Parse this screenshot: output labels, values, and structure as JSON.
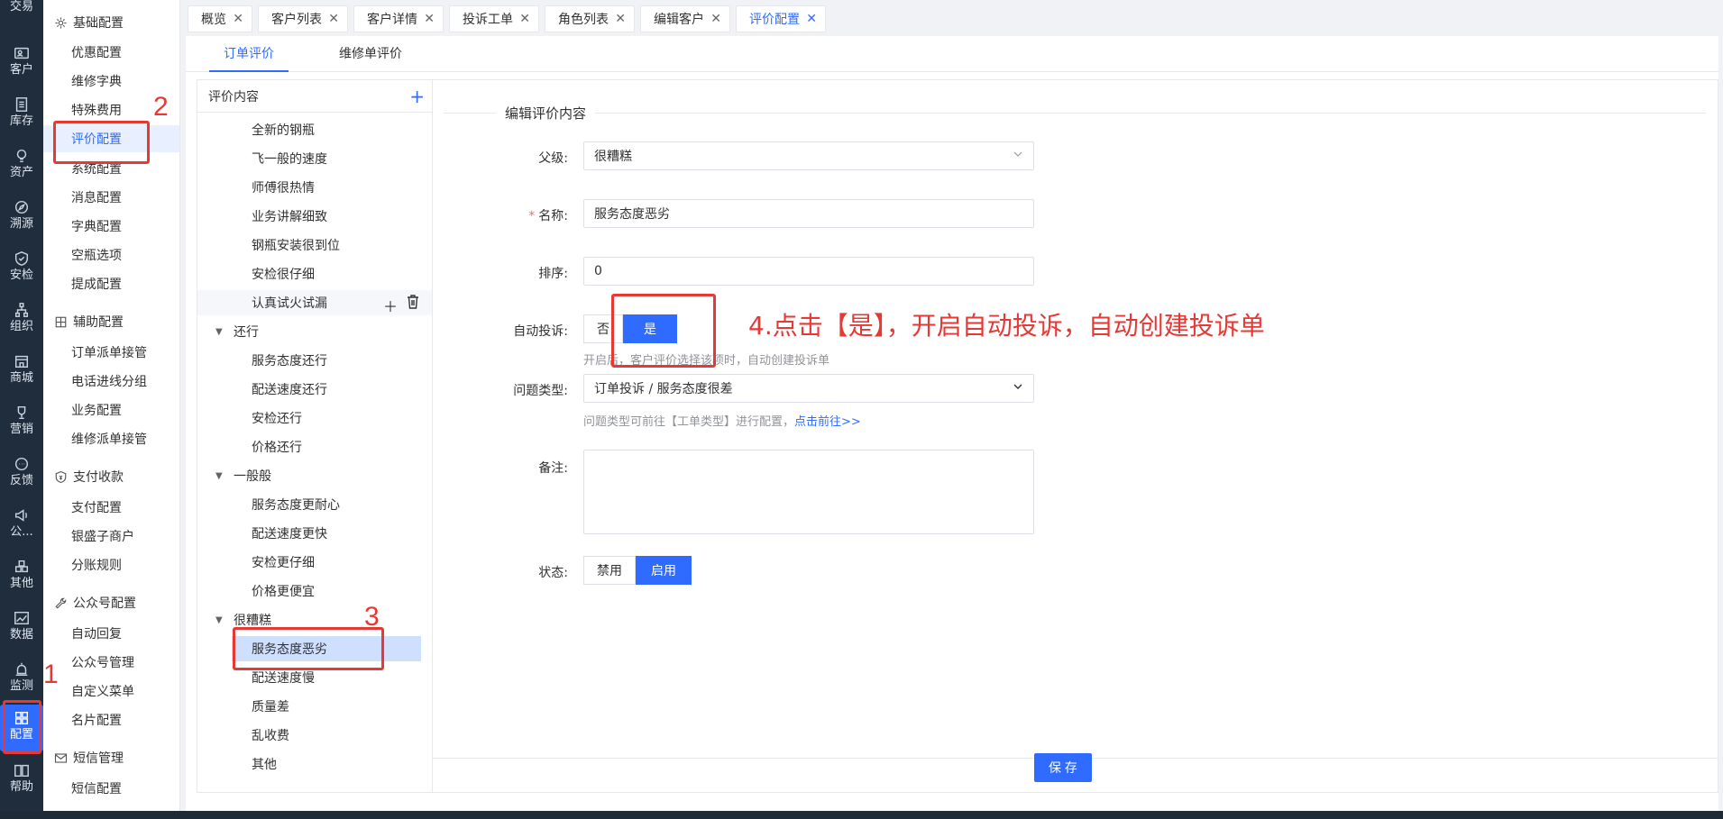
{
  "iconbar": {
    "items": [
      {
        "label": "交易"
      },
      {
        "label": "客户"
      },
      {
        "label": "库存"
      },
      {
        "label": "资产"
      },
      {
        "label": "溯源"
      },
      {
        "label": "安检"
      },
      {
        "label": "组织"
      },
      {
        "label": "商城"
      },
      {
        "label": "营销"
      },
      {
        "label": "反馈"
      },
      {
        "label": "公..."
      },
      {
        "label": "其他"
      },
      {
        "label": "数据"
      },
      {
        "label": "监测"
      },
      {
        "label": "配置"
      },
      {
        "label": "帮助"
      }
    ]
  },
  "menu": {
    "groups": [
      {
        "label": "基础配置"
      },
      {
        "label": "辅助配置"
      },
      {
        "label": "支付收款"
      },
      {
        "label": "公众号配置"
      },
      {
        "label": "短信管理"
      }
    ],
    "items": [
      {
        "label": "优惠配置"
      },
      {
        "label": "维修字典"
      },
      {
        "label": "特殊费用"
      },
      {
        "label": "评价配置"
      },
      {
        "label": "系统配置"
      },
      {
        "label": "消息配置"
      },
      {
        "label": "字典配置"
      },
      {
        "label": "空瓶选项"
      },
      {
        "label": "提成配置"
      },
      {
        "label": "订单派单接管"
      },
      {
        "label": "电话进线分组"
      },
      {
        "label": "业务配置"
      },
      {
        "label": "维修派单接管"
      },
      {
        "label": "支付配置"
      },
      {
        "label": "银盛子商户"
      },
      {
        "label": "分账规则"
      },
      {
        "label": "自动回复"
      },
      {
        "label": "公众号管理"
      },
      {
        "label": "自定义菜单"
      },
      {
        "label": "名片配置"
      },
      {
        "label": "短信配置"
      }
    ]
  },
  "tabs": [
    {
      "label": "概览"
    },
    {
      "label": "客户列表"
    },
    {
      "label": "客户详情"
    },
    {
      "label": "投诉工单"
    },
    {
      "label": "角色列表"
    },
    {
      "label": "编辑客户"
    },
    {
      "label": "评价配置"
    }
  ],
  "subtabs": [
    {
      "label": "订单评价"
    },
    {
      "label": "维修单评价"
    }
  ],
  "tree": {
    "title": "评价内容",
    "add_icon": "+",
    "nodes": [
      {
        "label": "全新的钢瓶"
      },
      {
        "label": "飞一般的速度"
      },
      {
        "label": "师傅很热情"
      },
      {
        "label": "业务讲解细致"
      },
      {
        "label": "钢瓶安装很到位"
      },
      {
        "label": "安检很仔细"
      },
      {
        "label": "认真试火试漏"
      },
      {
        "label": "还行"
      },
      {
        "label": "服务态度还行"
      },
      {
        "label": "配送速度还行"
      },
      {
        "label": "安检还行"
      },
      {
        "label": "价格还行"
      },
      {
        "label": "一般般"
      },
      {
        "label": "服务态度更耐心"
      },
      {
        "label": "配送速度更快"
      },
      {
        "label": "安检更仔细"
      },
      {
        "label": "价格更便宜"
      },
      {
        "label": "很糟糕"
      },
      {
        "label": "服务态度恶劣"
      },
      {
        "label": "配送速度慢"
      },
      {
        "label": "质量差"
      },
      {
        "label": "乱收费"
      },
      {
        "label": "其他"
      }
    ]
  },
  "form": {
    "legend": "编辑评价内容",
    "parent_label": "父级:",
    "parent_value": "很糟糕",
    "name_required": "*",
    "name_label": "名称:",
    "name_value": "服务态度恶劣",
    "sort_label": "排序:",
    "sort_value": "0",
    "auto_label": "自动投诉:",
    "auto_no": "否",
    "auto_yes": "是",
    "auto_hint": "开启后，客户评价选择该项时，自动创建投诉单",
    "type_label": "问题类型:",
    "type_value": "订单投诉 / 服务态度很差",
    "type_hint": "问题类型可前往【工单类型】进行配置，",
    "type_hint_link": "点击前往>>",
    "remark_label": "备注:",
    "remark_value": "",
    "status_label": "状态:",
    "status_off": "禁用",
    "status_on": "启用",
    "save": "保 存"
  },
  "annotations": {
    "num1": "1",
    "num2": "2",
    "num3": "3",
    "step4": "4.点击【是】，开启自动投诉，自动创建投诉单"
  },
  "colors": {
    "accent": "#2f6bff",
    "annotation": "#e53935",
    "sidebar": "#1f2d3d"
  }
}
